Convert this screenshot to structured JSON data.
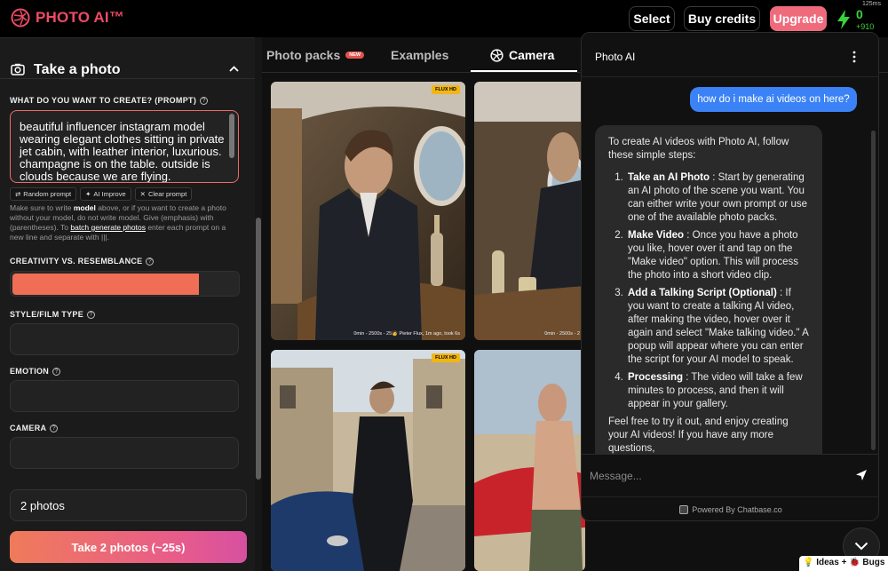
{
  "header": {
    "logo_text": "PHOTO AI™",
    "select_label": "Select",
    "buy_credits_label": "Buy credits",
    "upgrade_label": "Upgrade",
    "credits_value": "0",
    "credits_delta": "+910",
    "timer": "125ms"
  },
  "left_panel": {
    "section_title": "Take a photo",
    "prompt_label": "WHAT DO YOU WANT TO CREATE? (PROMPT)",
    "prompt_value": "beautiful influencer instagram model wearing elegant clothes sitting in private jet cabin, with leather interior, luxurious. champagne is on the table. outside is clouds because we are flying.",
    "chips": [
      "Random prompt",
      "AI Improve",
      "Clear prompt"
    ],
    "help": {
      "t1": "Make sure to write ",
      "b1": "model",
      "t2": " above, or if you want to create a photo without your model, do not write model. Give (emphasis) with (parentheses). To ",
      "link": "batch generate photos",
      "t3": " enter each prompt on a new line and separate with |||."
    },
    "creativity_label": "CREATIVITY VS. RESEMBLANCE",
    "creativity_fraction": 0.83,
    "style_label": "STYLE/FILM TYPE",
    "emotion_label": "EMOTION",
    "camera_label": "CAMERA",
    "photos_count": "2 photos",
    "take_button": "Take 2 photos (~25s)"
  },
  "main": {
    "tabs": [
      {
        "label": "Photo packs",
        "badge": "NEW"
      },
      {
        "label": "Examples"
      },
      {
        "label": "Camera"
      }
    ],
    "photos": [
      {
        "badge": "FLUX HD",
        "caption": "0min - 2500s - 25🧑 Pieter Flux, 1m ago, took 6s"
      },
      {
        "caption": "0min - 2500s - 2"
      },
      {
        "badge": "FLUX HD"
      },
      {}
    ]
  },
  "chat": {
    "title": "Photo AI",
    "user_message": "how do i make ai videos on here?",
    "bot_intro": "To create AI videos with Photo AI, follow these simple steps:",
    "steps": [
      {
        "title": "Take an AI Photo",
        "text": " : Start by generating an AI photo of the scene you want. You can either write your own prompt or use one of the available photo packs."
      },
      {
        "title": "Make Video",
        "text": " : Once you have a photo you like, hover over it and tap on the \"Make video\" option. This will process the photo into a short video clip."
      },
      {
        "title": "Add a Talking Script (Optional)",
        "text": " : If you want to create a talking AI video, after making the video, hover over it again and select \"Make talking video.\" A popup will appear where you can enter the script for your AI model to speak."
      },
      {
        "title": "Processing",
        "text": " : The video will take a few minutes to process, and then it will appear in your gallery."
      }
    ],
    "bot_outro": "Feel free to try it out, and enjoy creating your AI videos! If you have any more questions,",
    "input_placeholder": "Message...",
    "powered_by": "Powered By Chatbase.co"
  },
  "footer": {
    "ideas_label": "💡 Ideas + 🐞 Bugs"
  },
  "colors": {
    "brand": "#ef4b64",
    "accent": "#ef6e55",
    "chat_user": "#3b82f6",
    "credits": "#3ad13a",
    "flux_badge": "#f2b614"
  }
}
